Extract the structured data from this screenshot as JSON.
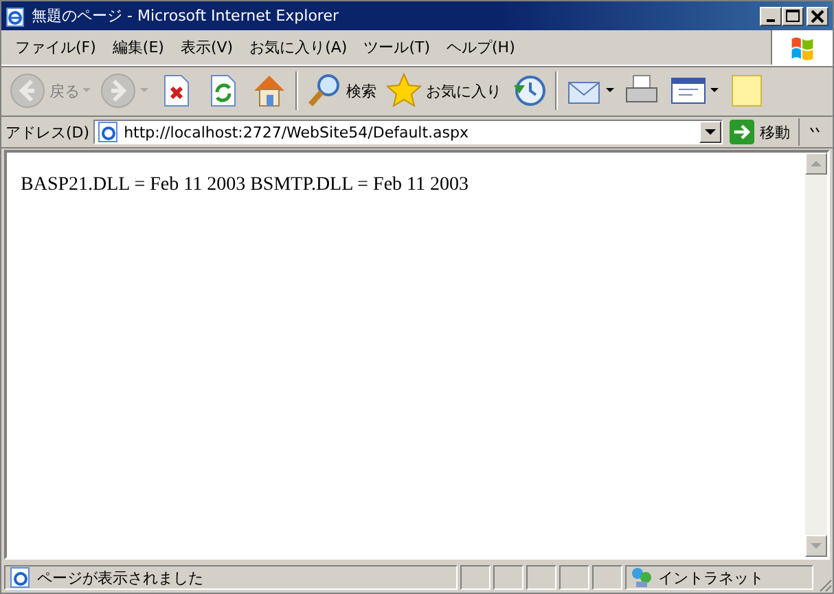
{
  "window": {
    "title": "無題のページ - Microsoft Internet Explorer"
  },
  "menu": [
    {
      "label": "ファイル(F)"
    },
    {
      "label": "編集(E)"
    },
    {
      "label": "表示(V)"
    },
    {
      "label": "お気に入り(A)"
    },
    {
      "label": "ツール(T)"
    },
    {
      "label": "ヘルプ(H)"
    }
  ],
  "toolbar": [
    {
      "kind": "back",
      "label": "戻る",
      "disabled": true,
      "dropdown": true
    },
    {
      "kind": "forward",
      "disabled": true,
      "dropdown": true
    },
    {
      "kind": "stop",
      "disabled": false,
      "dropdown": false
    },
    {
      "kind": "refresh",
      "disabled": false,
      "dropdown": false
    },
    {
      "kind": "home",
      "disabled": false,
      "dropdown": false
    },
    {
      "kind": "separator"
    },
    {
      "kind": "search",
      "label": "検索",
      "disabled": false,
      "dropdown": false
    },
    {
      "kind": "favorites",
      "label": "お気に入り",
      "disabled": false,
      "dropdown": false
    },
    {
      "kind": "history",
      "disabled": false,
      "dropdown": false
    },
    {
      "kind": "separator"
    },
    {
      "kind": "mail",
      "disabled": false,
      "dropdown": true
    },
    {
      "kind": "print",
      "disabled": false,
      "dropdown": false
    },
    {
      "kind": "edit",
      "disabled": false,
      "dropdown": true
    },
    {
      "kind": "note",
      "disabled": false,
      "dropdown": false
    }
  ],
  "address_bar": {
    "label": "アドレス(D)",
    "url": "http://localhost:2727/WebSite54/Default.aspx",
    "go": "移動"
  },
  "page": {
    "text": "BASP21.DLL = Feb 11 2003 BSMTP.DLL = Feb 11 2003"
  },
  "status_bar": {
    "text": "ページが表示されました",
    "zone": "イントラネット"
  }
}
